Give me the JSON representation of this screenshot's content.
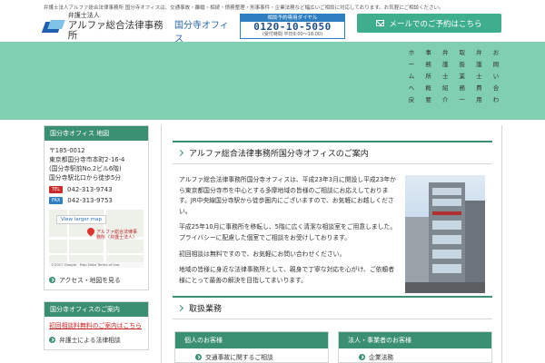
{
  "topline": "弁護士法人アルファ総合法律事務所 国分寺オフィスは、交通事故・離婚・相続・債務整理・刑事事件・企業法務など幅広いご相談に対応しております。お気軽にご相談ください。",
  "header": {
    "logo_sub": "弁護士法人",
    "logo_main": "アルファ総合法律事務所",
    "logo_office": "国分寺オフィス",
    "phone_head": "相談予約専用ダイヤル",
    "phone_number": "0120-10-5050",
    "phone_hours": "(受付時間 平日9:00〜18:00)",
    "mail_button": "メールでのご予約はこちら"
  },
  "nav": [
    {
      "label": "ホームへ戻る"
    },
    {
      "label": "事務所概要"
    },
    {
      "label": "弁護士紹介"
    },
    {
      "label": "取扱業務一覧"
    },
    {
      "label": "弁護士費用"
    },
    {
      "label": "お問い合わせ"
    }
  ],
  "sidebar": {
    "office_head": "国分寺オフィス 地図",
    "address": [
      "〒185-0012",
      "東京都国分寺市本町2-16-4",
      "(国分寺駅前No.2ビル6階)",
      "国分寺駅北口から徒歩5分",
      ""
    ],
    "tel_tag": "TEL",
    "tel": "042-313-9743",
    "fax_tag": "FAX",
    "fax": "042-313-9753",
    "map_button": "View larger map",
    "map_label": "アルファ総合法律事務所（弁護士法人）",
    "map_footer": "©2017 Google · Map Data    Terms of Use",
    "access_link": "アクセス・地図を見る",
    "box2_head": "国分寺オフィスのご案内",
    "box2_link_red": "初回相談料無料のご案内はこちら",
    "box2_link": "弁護士による法律相談"
  },
  "main": {
    "section1_title": "アルファ総合法律事務所国分寺オフィスのご案内",
    "paragraphs": [
      "アルファ総合法律事務所国分寺オフィスは、平成23年3月に開設し平成23年から東京都国分寺市を中心とする多摩地域の皆様のご相談にお応えしております。JR中央線国分寺駅から徒歩圏内にございますので、お気軽にお越しください。",
      "平成25年10月に事務所を移転し、5階に広く清潔な相談室をご用意しました。プライバシーに配慮した個室でご相談をお受けしております。",
      "初回相談は無料ですので、お気軽にお問い合わせください。",
      "地域の皆様に身近な法律事務所として、親身で丁寧な対応を心がけ、ご依頼者様にとって最善の解決を目指してまいります。"
    ],
    "section2_title": "取扱業務",
    "card1_head": "個人のお客様",
    "card1_link": "交通事故に関するご相談",
    "card2_head": "法人・事業者のお客様",
    "card2_link": "企業法務"
  },
  "colors": {
    "accent": "#3b8f73",
    "band": "#7fcfb0",
    "mail_button": "#3fae8e",
    "phone_blue": "#2f7fc0"
  }
}
